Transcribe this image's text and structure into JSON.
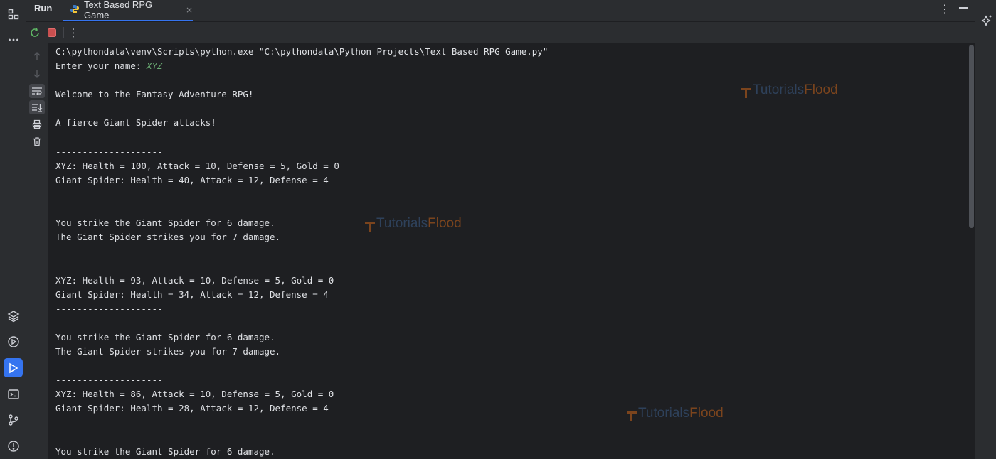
{
  "header": {
    "panel_label": "Run",
    "tab_title": "Text Based RPG Game",
    "tab_close": "×",
    "more": "⋮"
  },
  "toolbar": {
    "more": "⋮"
  },
  "console": {
    "lines": [
      {
        "text": "C:\\pythondata\\venv\\Scripts\\python.exe \"C:\\pythondata\\Python Projects\\Text Based RPG Game.py\""
      },
      {
        "text": "Enter your name: ",
        "input": "XYZ"
      },
      {
        "text": ""
      },
      {
        "text": "Welcome to the Fantasy Adventure RPG!"
      },
      {
        "text": ""
      },
      {
        "text": "A fierce Giant Spider attacks!"
      },
      {
        "text": ""
      },
      {
        "text": "--------------------"
      },
      {
        "text": "XYZ: Health = 100, Attack = 10, Defense = 5, Gold = 0"
      },
      {
        "text": "Giant Spider: Health = 40, Attack = 12, Defense = 4"
      },
      {
        "text": "--------------------"
      },
      {
        "text": ""
      },
      {
        "text": "You strike the Giant Spider for 6 damage."
      },
      {
        "text": "The Giant Spider strikes you for 7 damage."
      },
      {
        "text": ""
      },
      {
        "text": "--------------------"
      },
      {
        "text": "XYZ: Health = 93, Attack = 10, Defense = 5, Gold = 0"
      },
      {
        "text": "Giant Spider: Health = 34, Attack = 12, Defense = 4"
      },
      {
        "text": "--------------------"
      },
      {
        "text": ""
      },
      {
        "text": "You strike the Giant Spider for 6 damage."
      },
      {
        "text": "The Giant Spider strikes you for 7 damage."
      },
      {
        "text": ""
      },
      {
        "text": "--------------------"
      },
      {
        "text": "XYZ: Health = 86, Attack = 10, Defense = 5, Gold = 0"
      },
      {
        "text": "Giant Spider: Health = 28, Attack = 12, Defense = 4"
      },
      {
        "text": "--------------------"
      },
      {
        "text": ""
      },
      {
        "text": "You strike the Giant Spider for 6 damage."
      }
    ]
  },
  "watermark": {
    "part_a": "Tutorials",
    "part_b": "Flood"
  },
  "icons": {
    "left_strip_top": [
      "project-structure-icon",
      "more-tools-icon"
    ],
    "left_strip_bottom": [
      "layers-icon",
      "services-icon",
      "run-icon",
      "terminal-icon",
      "git-icon",
      "problems-icon"
    ],
    "toolbar": [
      "rerun-icon",
      "stop-icon"
    ],
    "gutter": [
      "scroll-up-icon",
      "scroll-down-icon",
      "soft-wrap-icon",
      "scroll-to-end-icon",
      "print-icon",
      "clear-icon"
    ],
    "right_strip": [
      "ai-assistant-icon"
    ]
  },
  "colors": {
    "accent": "#3574f0",
    "input_text": "#6aab73",
    "stop": "#db5c5c"
  }
}
